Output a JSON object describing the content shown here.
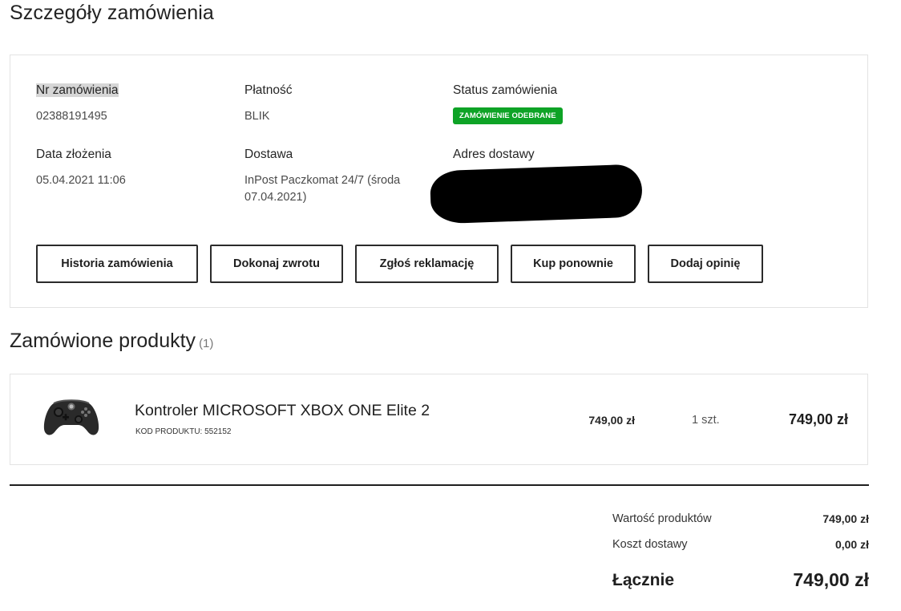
{
  "page": {
    "title": "Szczegóły zamówienia"
  },
  "details": {
    "order_number": {
      "label": "Nr zamówienia",
      "value": "02388191495"
    },
    "payment": {
      "label": "Płatność",
      "value": "BLIK"
    },
    "status": {
      "label": "Status zamówienia",
      "badge": "ZAMÓWIENIE ODEBRANE",
      "badge_color": "#0ea326"
    },
    "date": {
      "label": "Data złożenia",
      "value": "05.04.2021 11:06"
    },
    "delivery": {
      "label": "Dostawa",
      "value_line1": "InPost Paczkomat 24/7 (środa",
      "value_line2": "07.04.2021)"
    },
    "address": {
      "label": "Adres dostawy"
    }
  },
  "actions": {
    "history": "Historia zamówienia",
    "return": "Dokonaj zwrotu",
    "complaint": "Zgłoś reklamację",
    "buy_again": "Kup ponownie",
    "review": "Dodaj opinię"
  },
  "products_section": {
    "title": "Zamówione produkty",
    "count": "(1)"
  },
  "products": [
    {
      "image_icon": "xbox-controller-icon",
      "name": "Kontroler MICROSOFT XBOX ONE Elite 2",
      "code": "KOD PRODUKTU: 552152",
      "price": "749,00 zł",
      "quantity": "1 szt.",
      "total": "749,00 zł"
    }
  ],
  "summary": {
    "products_value": {
      "label": "Wartość produktów",
      "value": "749,00 zł"
    },
    "shipping": {
      "label": "Koszt dostawy",
      "value": "0,00 zł"
    },
    "total": {
      "label": "Łącznie",
      "value": "749,00 zł"
    }
  }
}
